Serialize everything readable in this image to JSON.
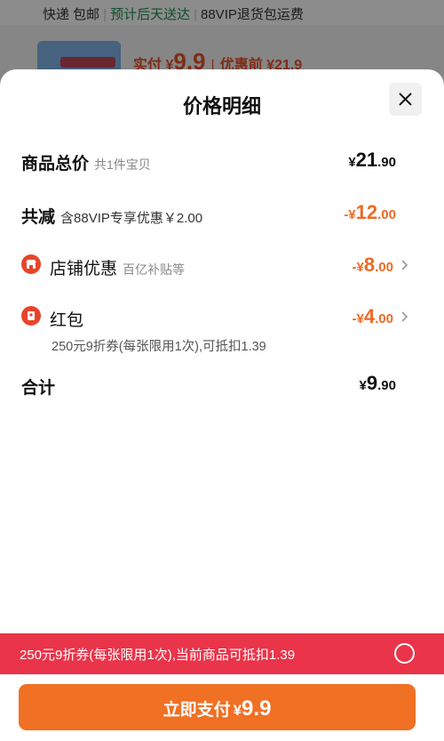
{
  "background": {
    "shipping_method": "快递 包邮",
    "delivery_estimate": "预计后天送达",
    "vip_return": "88VIP退货包运费",
    "paid_label": "实付",
    "paid_currency": "¥",
    "paid_amount": "9.9",
    "before_label": "优惠前",
    "before_amount": "¥21.9"
  },
  "sheet": {
    "title": "价格明细",
    "close_icon": "close-icon"
  },
  "rows": {
    "total": {
      "label": "商品总价",
      "sub": "共1件宝贝",
      "currency": "¥",
      "int": "21",
      "dec": ".90"
    },
    "reduction": {
      "label": "共减",
      "sub": "含88VIP专享优惠￥2.00",
      "currency": "-¥",
      "int": "12",
      "dec": ".00"
    },
    "store_discount": {
      "icon": "store-icon",
      "label": "店铺优惠",
      "sub": "百亿补贴等",
      "currency": "-¥",
      "int": "8",
      "dec": ".00"
    },
    "red_packet": {
      "icon": "red-packet-icon",
      "label": "红包",
      "currency": "-¥",
      "int": "4",
      "dec": ".00",
      "note": "250元9折券(每张限用1次),可抵扣1.39"
    },
    "subtotal": {
      "label": "合计",
      "currency": "¥",
      "int": "9",
      "dec": ".90"
    }
  },
  "coupon_banner": {
    "text": "250元9折券(每张限用1次),当前商品可抵扣1.39"
  },
  "pay_button": {
    "label": "立即支付",
    "currency": "¥",
    "amount": "9.9"
  },
  "colors": {
    "accent_orange": "#f07024",
    "discount_orange": "#ee6a25",
    "coupon_red": "#e9344a",
    "icon_red": "#e8442a"
  }
}
